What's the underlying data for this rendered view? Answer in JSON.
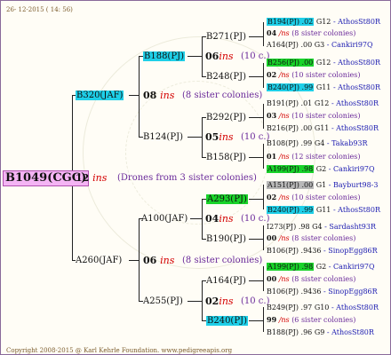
{
  "date": "26- 12-2015 ( 14: 56)",
  "copyright": "Copyright 2008-2015 @ Karl Kehrle Foundation.   www.pedigreeapis.org",
  "root": "B1049(CGC)",
  "root_info": {
    "count": "12",
    "ins": "ins",
    "note": "(Drones from 3 sister colonies)"
  },
  "gen1": {
    "top": {
      "label": "B320(JAF)",
      "count": "08",
      "ins": "ins",
      "note": "(8 sister colonies)"
    },
    "bottom": {
      "label": "A260(JAF)",
      "count": "06",
      "ins": "ins",
      "note": "(8 sister colonies)"
    }
  },
  "gen2": {
    "b188": {
      "label": "B188(PJ)",
      "count": "06",
      "ins": "ins",
      "note": "(10 c.)"
    },
    "b124": {
      "label": "B124(PJ)",
      "count": "05",
      "ins": "ins",
      "note": "(10 c.)"
    },
    "a100": {
      "label": "A100(JAF)",
      "count": "04",
      "ins": "ins",
      "note": "(10 c.)"
    },
    "a255": {
      "label": "A255(PJ)",
      "count": "02",
      "ins": "ins",
      "note": "(10 c.)"
    }
  },
  "gen3": {
    "b271": "B271(PJ)",
    "b248": "B248(PJ)",
    "b292": "B292(PJ)",
    "b158": "B158(PJ)",
    "a293": "A293(PJ)",
    "b190": "B190(PJ)",
    "a164": "A164(PJ)",
    "b240": "B240(PJ)"
  },
  "gen4": [
    {
      "id": "B194(PJ)",
      "val": ".02",
      "code": "G12",
      "loc": "- AthosSt80R"
    },
    {
      "count": "04",
      "ins": "/ns",
      "note": "(8 sister colonies)"
    },
    {
      "id": "A164(PJ)",
      "val": ".00",
      "code": "G3",
      "loc": "- Cankiri97Q"
    },
    {
      "id": "B256(PJ)",
      "val": ".00",
      "code": "G12",
      "loc": "- AthosSt80R"
    },
    {
      "count": "02",
      "ins": "/ns",
      "note": "(10 sister colonies)"
    },
    {
      "id": "B240(PJ)",
      "val": ".99",
      "code": "G11",
      "loc": "- AthosSt80R"
    },
    {
      "id": "B191(PJ)",
      "val": ".01",
      "code": "G12",
      "loc": "- AthosSt80R"
    },
    {
      "count": "03",
      "ins": "/ns",
      "note": "(10 sister colonies)"
    },
    {
      "id": "B216(PJ)",
      "val": ".00",
      "code": "G11",
      "loc": "- AthosSt80R"
    },
    {
      "id": "B108(PJ)",
      "val": ".99",
      "code": "G4",
      "loc": "- Takab93R"
    },
    {
      "count": "01",
      "ins": "/ns",
      "note": "(12 sister colonies)"
    },
    {
      "id": "A199(PJ)",
      "val": ".98",
      "code": "G2",
      "loc": "- Cankiri97Q"
    },
    {
      "id": "A151(PJ)",
      "val": ".00",
      "code": "G1",
      "loc": "- Bayburt98-3"
    },
    {
      "count": "02",
      "ins": "/ns",
      "note": "(10 sister colonies)"
    },
    {
      "id": "B240(PJ)",
      "val": ".99",
      "code": "G11",
      "loc": "- AthosSt80R"
    },
    {
      "id": "I273(PJ)",
      "val": ".98",
      "code": "G4",
      "loc": "- Sardasht93R"
    },
    {
      "count": "00",
      "ins": "/ns",
      "note": "(8 sister colonies)"
    },
    {
      "id": "B106(PJ)",
      "val": ".9436",
      "code": "",
      "loc": "- SinopEgg86R"
    },
    {
      "id": "A199(PJ)",
      "val": ".98",
      "code": "G2",
      "loc": "- Cankiri97Q"
    },
    {
      "count": "00",
      "ins": "/ns",
      "note": "(8 sister colonies)"
    },
    {
      "id": "B106(PJ)",
      "val": ".9436",
      "code": "",
      "loc": "- SinopEgg86R"
    },
    {
      "id": "B249(PJ)",
      "val": ".97",
      "code": "G10",
      "loc": "- AthosSt80R"
    },
    {
      "count": "99",
      "ins": "/ns",
      "note": "(6 sister colonies)"
    },
    {
      "id": "B188(PJ)",
      "val": ".96",
      "code": "G9",
      "loc": "- AthosSt80R"
    }
  ]
}
